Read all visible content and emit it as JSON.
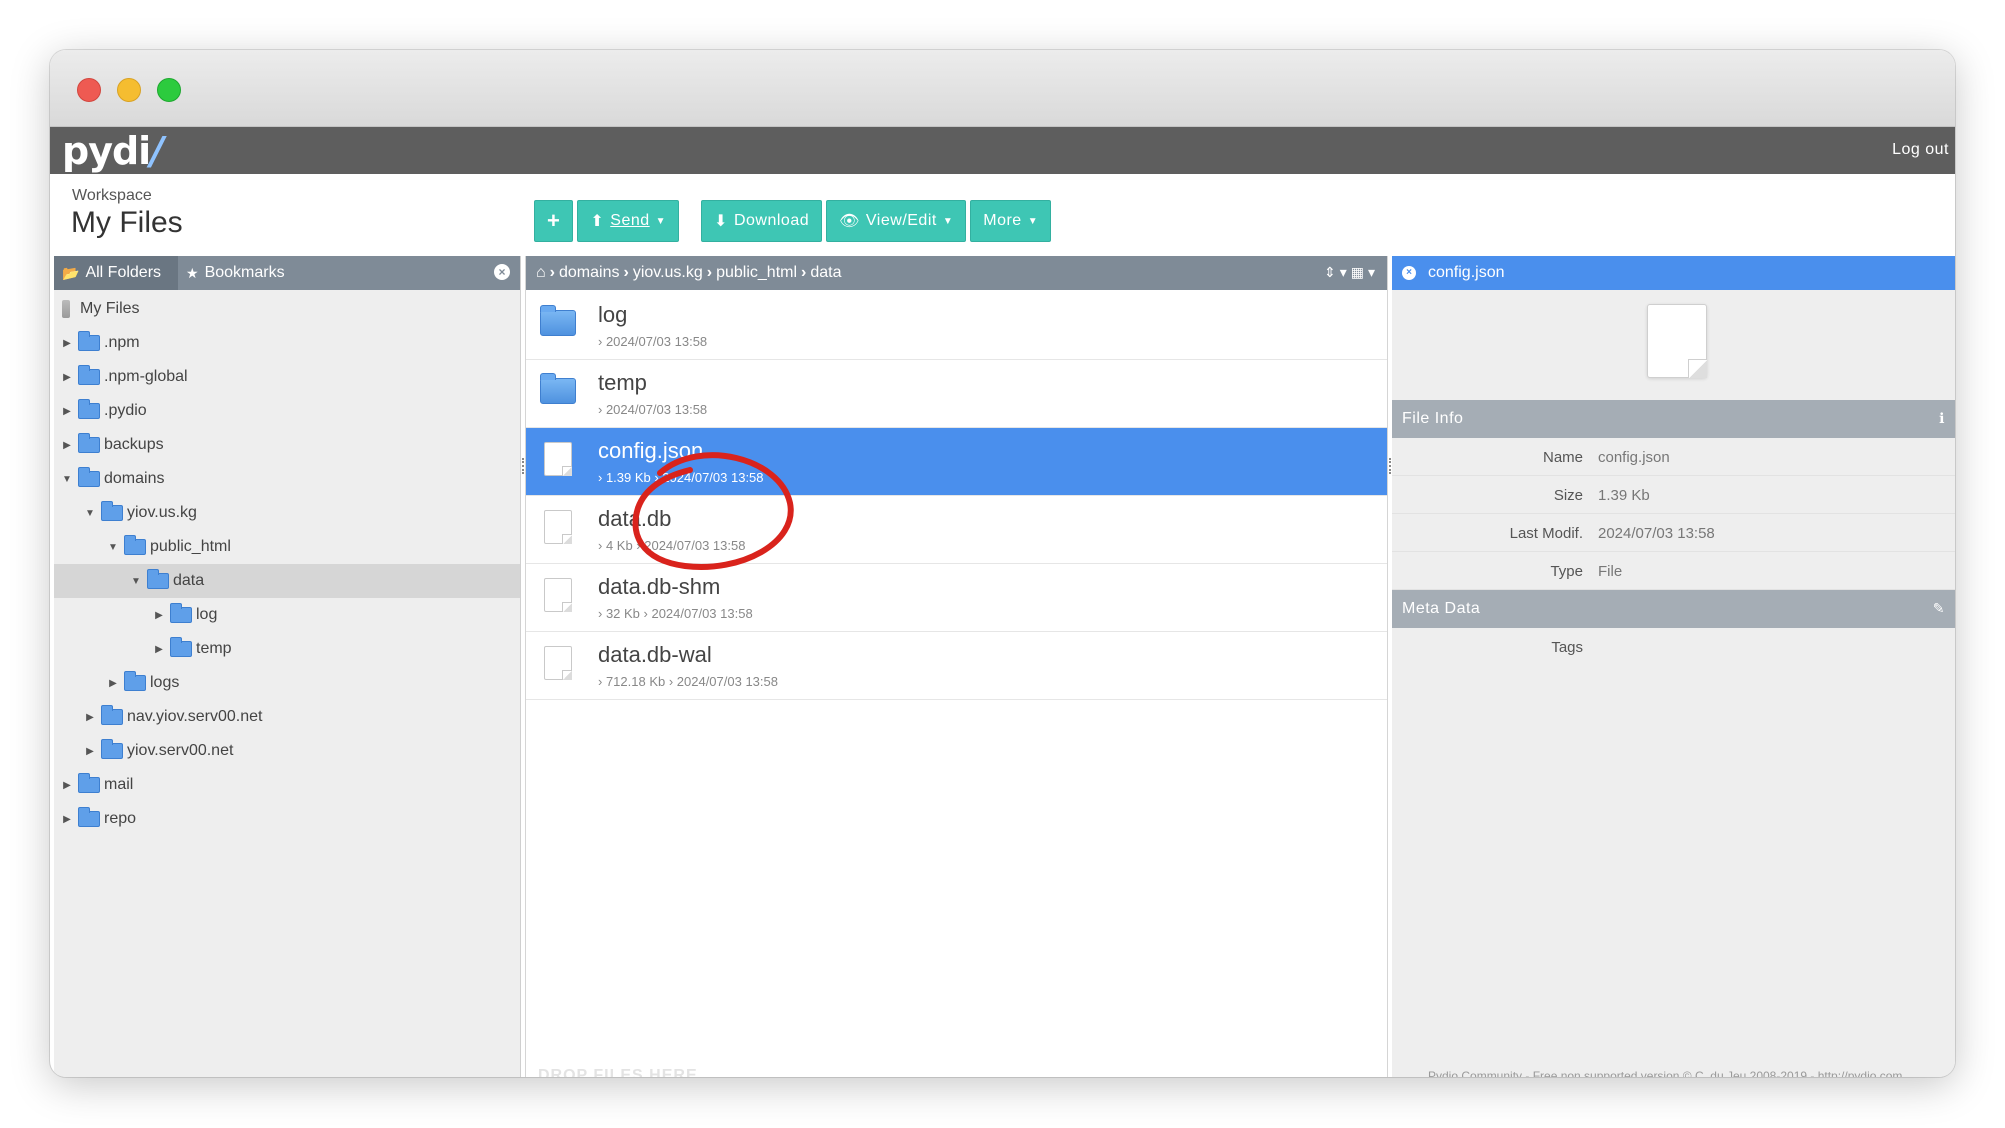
{
  "app": {
    "logo_text": "pydi",
    "logo_slash": "/",
    "logout": "Log out"
  },
  "workspace": {
    "label": "Workspace",
    "title": "My Files"
  },
  "toolbar": {
    "add_icon": "+",
    "send": "Send",
    "download": "Download",
    "view_edit": "View/Edit",
    "more": "More"
  },
  "left_panel": {
    "tab_all_folders": "All Folders",
    "tab_bookmarks": "Bookmarks",
    "tree": [
      {
        "label": "My Files",
        "depth": 0,
        "expand": "",
        "type": "root"
      },
      {
        "label": ".npm",
        "depth": 0,
        "expand": "▶",
        "type": "folder"
      },
      {
        "label": ".npm-global",
        "depth": 0,
        "expand": "▶",
        "type": "folder"
      },
      {
        "label": ".pydio",
        "depth": 0,
        "expand": "▶",
        "type": "folder"
      },
      {
        "label": "backups",
        "depth": 0,
        "expand": "▶",
        "type": "folder"
      },
      {
        "label": "domains",
        "depth": 0,
        "expand": "▼",
        "type": "folder"
      },
      {
        "label": "yiov.us.kg",
        "depth": 1,
        "expand": "▼",
        "type": "folder"
      },
      {
        "label": "public_html",
        "depth": 2,
        "expand": "▼",
        "type": "folder"
      },
      {
        "label": "data",
        "depth": 3,
        "expand": "▼",
        "type": "folder",
        "selected": true
      },
      {
        "label": "log",
        "depth": 4,
        "expand": "▶",
        "type": "folder"
      },
      {
        "label": "temp",
        "depth": 4,
        "expand": "▶",
        "type": "folder"
      },
      {
        "label": "logs",
        "depth": 2,
        "expand": "▶",
        "type": "folder"
      },
      {
        "label": "nav.yiov.serv00.net",
        "depth": 1,
        "expand": "▶",
        "type": "folder"
      },
      {
        "label": "yiov.serv00.net",
        "depth": 1,
        "expand": "▶",
        "type": "folder"
      },
      {
        "label": "mail",
        "depth": 0,
        "expand": "▶",
        "type": "folder"
      },
      {
        "label": "repo",
        "depth": 0,
        "expand": "▶",
        "type": "folder"
      }
    ]
  },
  "breadcrumb": {
    "items": [
      "domains",
      "yiov.us.kg",
      "public_html",
      "data"
    ]
  },
  "files": [
    {
      "name": "log",
      "meta": "›  2024/07/03 13:58",
      "kind": "folder"
    },
    {
      "name": "temp",
      "meta": "›  2024/07/03 13:58",
      "kind": "folder"
    },
    {
      "name": "config.json",
      "meta": "›  1.39 Kb  ›  2024/07/03 13:58",
      "kind": "file",
      "selected": true
    },
    {
      "name": "data.db",
      "meta": "›  4 Kb  ›  2024/07/03 13:58",
      "kind": "file"
    },
    {
      "name": "data.db-shm",
      "meta": "›  32 Kb  ›  2024/07/03 13:58",
      "kind": "file"
    },
    {
      "name": "data.db-wal",
      "meta": "›  712.18 Kb  ›  2024/07/03 13:58",
      "kind": "file"
    }
  ],
  "drop_hint": "DROP FILES HERE",
  "details": {
    "title": "config.json",
    "file_info_title": "File Info",
    "rows": [
      {
        "key": "Name",
        "value": "config.json"
      },
      {
        "key": "Size",
        "value": "1.39 Kb"
      },
      {
        "key": "Last Modif.",
        "value": "2024/07/03 13:58"
      },
      {
        "key": "Type",
        "value": "File"
      }
    ],
    "meta_title": "Meta Data",
    "tags_label": "Tags",
    "footer": "Pydio Community - Free non supported version © C. du Jeu 2008-2019 - http://pydio.com"
  },
  "colors": {
    "accent": "#3ec6b4",
    "selection": "#4a8fed",
    "annotation": "#d9231c"
  }
}
